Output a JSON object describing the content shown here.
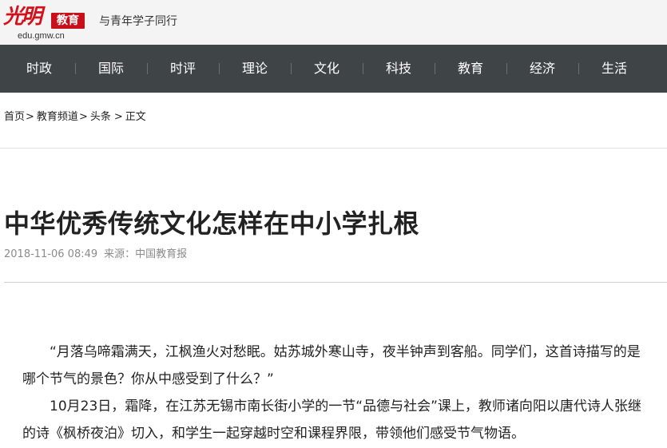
{
  "header": {
    "logo_script": "光明",
    "logo_badge": "教育",
    "logo_domain": "edu.gmw.cn",
    "slogan": "与青年学子同行"
  },
  "nav": {
    "items": [
      "时政",
      "国际",
      "时评",
      "理论",
      "文化",
      "科技",
      "教育",
      "经济",
      "生活"
    ]
  },
  "breadcrumb": {
    "home": "首页",
    "channel": "教育频道",
    "section": "头条",
    "current": "正文",
    "sep": ">"
  },
  "article": {
    "title": "中华优秀传统文化怎样在中小学扎根",
    "date": "2018-11-06 08:49",
    "source": "来源：中国教育报",
    "paragraphs": [
      "“月落乌啼霜满天，江枫渔火对愁眠。姑苏城外寒山寺，夜半钟声到客船。同学们，这首诗描写的是哪个节气的景色？你从中感受到了什么？”",
      "10月23日，霜降，在江苏无锡市南长街小学的一节“品德与社会”课上，教师诸向阳以唐代诗人张继的诗《枫桥夜泊》切入，和学生一起穿越时空和课程界限，带领他们感受节气物语。"
    ]
  },
  "colors": {
    "nav_bg": "#3f4447",
    "brand_red": "#c8101a",
    "meta_gray": "#8b8b8b"
  }
}
